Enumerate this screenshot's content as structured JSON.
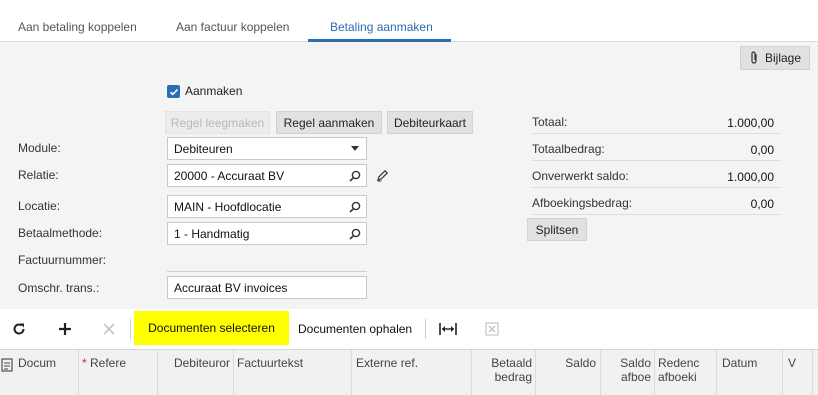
{
  "tabs": [
    {
      "label": "Aan betaling koppelen"
    },
    {
      "label": "Aan factuur koppelen"
    },
    {
      "label": "Betaling aanmaken"
    }
  ],
  "attachment_button": {
    "label": "Bijlage",
    "icon": "paperclip-icon"
  },
  "checkbox": {
    "label": "Aanmaken",
    "checked": true
  },
  "actions": {
    "clear_rule": "Regel leegmaken",
    "create_rule": "Regel aanmaken",
    "debtor_card": "Debiteurkaart"
  },
  "form": {
    "module": {
      "label": "Module:",
      "value": "Debiteuren"
    },
    "relation": {
      "label": "Relatie:",
      "value": "20000 - Accuraat BV"
    },
    "location": {
      "label": "Locatie:",
      "value": "MAIN - Hoofdlocatie"
    },
    "payment_method": {
      "label": "Betaalmethode:",
      "value": "1 - Handmatig"
    },
    "invoice_number": {
      "label": "Factuurnummer:",
      "value": ""
    },
    "description": {
      "label": "Omschr. trans.:",
      "value": "Accuraat BV invoices"
    }
  },
  "totals": [
    {
      "label": "Totaal:",
      "value": "1.000,00"
    },
    {
      "label": "Totaalbedrag:",
      "value": "0,00"
    },
    {
      "label": "Onverwerkt saldo:",
      "value": "1.000,00"
    },
    {
      "label": "Afboekingsbedrag:",
      "value": "0,00"
    }
  ],
  "split_button": "Splitsen",
  "toolbar": {
    "select_documents": "Documenten selecteren",
    "fetch_documents": "Documenten ophalen"
  },
  "grid_columns": {
    "docum": "Docum",
    "refer": "Refere",
    "debtor": "Debiteuror",
    "invoice_text": "Factuurtekst",
    "external_ref": "Externe ref.",
    "pay_amount_1": "Betaald",
    "pay_amount_2": "bedrag",
    "balance": "Saldo",
    "balance_wo_1": "Saldo",
    "balance_wo_2": "afboe",
    "reason_1": "Redenc",
    "reason_2": "afboeki",
    "date": "Datum",
    "v": "V"
  },
  "colors": {
    "accent": "#2a6fb0",
    "highlight": "#ffff00"
  }
}
